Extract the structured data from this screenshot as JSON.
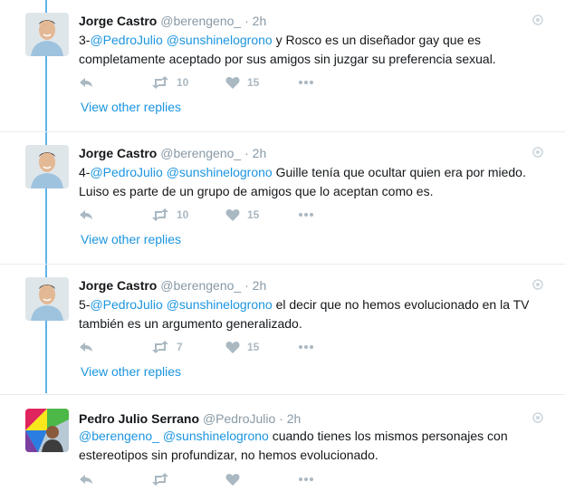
{
  "tweets": [
    {
      "name": "Jorge Castro",
      "handle": "@berengeno_",
      "sep": "·",
      "time": "2h",
      "text_prefix": "3-",
      "mention1": "@PedroJulio",
      "mention2": "@sunshinelogrono",
      "text_body": " y Rosco es un diseñador gay que es completamente aceptado por sus amigos sin juzgar su preferencia sexual.",
      "retweets": "10",
      "likes": "15",
      "view_replies": "View other replies",
      "avatar": "person-photo"
    },
    {
      "name": "Jorge Castro",
      "handle": "@berengeno_",
      "sep": "·",
      "time": "2h",
      "text_prefix": "4-",
      "mention1": "@PedroJulio",
      "mention2": "@sunshinelogrono",
      "text_body": " Guille tenía que ocultar quien era por miedo. Luiso es parte de un grupo de amigos que lo aceptan como es.",
      "retweets": "10",
      "likes": "15",
      "view_replies": "View other replies",
      "avatar": "person-photo"
    },
    {
      "name": "Jorge Castro",
      "handle": "@berengeno_",
      "sep": "·",
      "time": "2h",
      "text_prefix": "5-",
      "mention1": "@PedroJulio",
      "mention2": "@sunshinelogrono",
      "text_body": " el decir que no hemos evolucionado en la TV también es un argumento generalizado.",
      "retweets": "7",
      "likes": "15",
      "view_replies": "View other replies",
      "avatar": "person-photo"
    },
    {
      "name": "Pedro Julio Serrano",
      "handle": "@PedroJulio",
      "sep": "·",
      "time": "2h",
      "text_prefix": "",
      "mention1": "@berengeno_",
      "mention2": "@sunshinelogrono",
      "text_body": " cuando tienes los mismos personajes con estereotipos sin profundizar, no hemos evolucionado.",
      "retweets": "",
      "likes": "",
      "avatar": "rainbow-umbrella-photo"
    }
  ],
  "icons": {
    "reply": "reply-icon",
    "retweet": "retweet-icon",
    "like": "heart-icon",
    "more": "more-dots-icon",
    "caret": "globe-icon"
  },
  "colors": {
    "link": "#1b95e0",
    "thread_line": "#5fb3e8",
    "muted": "#8899a6",
    "icon": "#aab8c2"
  }
}
